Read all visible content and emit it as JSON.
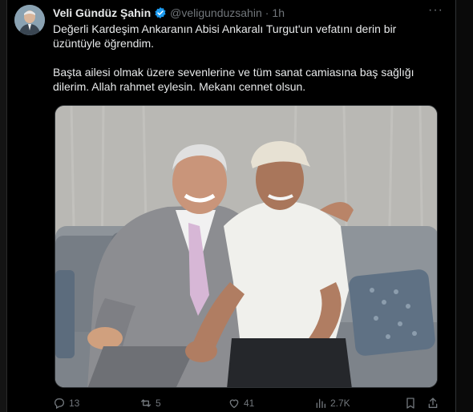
{
  "post": {
    "author_name": "Veli Gündüz Şahin",
    "handle": "@veligunduzsahin",
    "separator": "·",
    "time": "1h",
    "more_label": "···",
    "text_paragraph_1": "Değerli Kardeşim Ankaranın Abisi Ankaralı Turgut'un vefatını derin bir üzüntüyle öğrendim.",
    "text_paragraph_2": "Başta ailesi olmak üzere sevenlerine ve tüm sanat camiasına baş sağlığı dilerim. Allah rahmet eylesin. Mekanı cennet olsun.",
    "verified_icon": "verified-badge-icon",
    "verified_color": "#1d9bf0"
  },
  "actions": {
    "replies": "13",
    "reposts": "5",
    "likes": "41",
    "views": "2.7K",
    "icons": [
      "reply-icon",
      "repost-icon",
      "like-icon",
      "views-icon",
      "bookmark-icon",
      "share-icon"
    ]
  },
  "colors": {
    "background": "#000000",
    "text": "#e7e9ea",
    "muted": "#71767b"
  }
}
